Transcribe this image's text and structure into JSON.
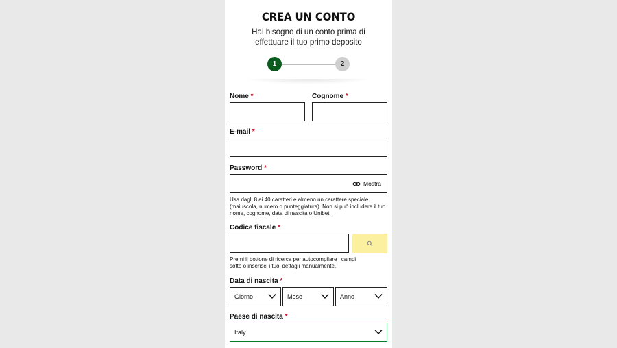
{
  "header": {
    "title": "CREA UN CONTO",
    "subtitle": "Hai bisogno di un conto prima di effettuare il tuo primo deposito"
  },
  "stepper": {
    "steps": [
      "1",
      "2"
    ],
    "active_step": 1
  },
  "form": {
    "required_mark": "*",
    "nome": {
      "label": "Nome",
      "value": ""
    },
    "cognome": {
      "label": "Cognome",
      "value": ""
    },
    "email": {
      "label": "E-mail",
      "value": ""
    },
    "password": {
      "label": "Password",
      "value": "",
      "show_label": "Mostra",
      "hint": "Usa dagli 8 ai 40 caratteri e almeno un carattere speciale (maiuscola, numero o punteggiatura). Non si può includere il tuo nome, cognome, data di nascita o Unibet."
    },
    "codice_fiscale": {
      "label": "Codice fiscale",
      "value": "",
      "hint": "Premi il bottone di ricerca per autocompilare i campi sotto o inserisci i tuoi dettagli manualmente.",
      "search_icon": "search-icon"
    },
    "data_di_nascita": {
      "label": "Data di nascita",
      "giorno": "Giorno",
      "mese": "Mese",
      "anno": "Anno"
    },
    "paese_di_nascita": {
      "label": "Paese di nascita",
      "value": "Italy"
    }
  },
  "colors": {
    "brand_green": "#0b5a1d",
    "required_red": "#c8102e",
    "search_button_bg": "#fbf0a0",
    "focus_green": "#0b7a2b"
  }
}
